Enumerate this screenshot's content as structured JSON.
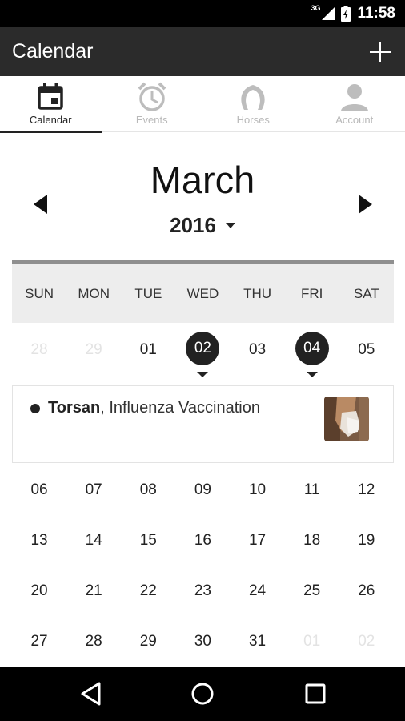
{
  "status_bar": {
    "network": "3G",
    "time": "11:58"
  },
  "app_bar": {
    "title": "Calendar",
    "add_icon": "plus-icon"
  },
  "tabs": [
    {
      "label": "Calendar",
      "icon": "calendar-icon",
      "active": true
    },
    {
      "label": "Events",
      "icon": "alarm-clock-icon",
      "active": false
    },
    {
      "label": "Horses",
      "icon": "horseshoe-icon",
      "active": false
    },
    {
      "label": "Account",
      "icon": "person-icon",
      "active": false
    }
  ],
  "calendar": {
    "month": "March",
    "year": "2016",
    "weekdays": [
      "SUN",
      "MON",
      "TUE",
      "WED",
      "THU",
      "FRI",
      "SAT"
    ],
    "weeks": [
      [
        "28",
        "29",
        "01",
        "02",
        "03",
        "04",
        "05"
      ],
      [
        "06",
        "07",
        "08",
        "09",
        "10",
        "11",
        "12"
      ],
      [
        "13",
        "14",
        "15",
        "16",
        "17",
        "18",
        "19"
      ],
      [
        "20",
        "21",
        "22",
        "23",
        "24",
        "25",
        "26"
      ],
      [
        "27",
        "28",
        "29",
        "30",
        "31",
        "01",
        "02"
      ]
    ]
  },
  "event": {
    "horse": "Torsan",
    "description": ", Influenza Vaccination"
  },
  "colors": {
    "app_bar": "#2b2b2b",
    "accent": "#222222",
    "muted": "#e3e3e3",
    "weekday_bg": "#ededed"
  }
}
